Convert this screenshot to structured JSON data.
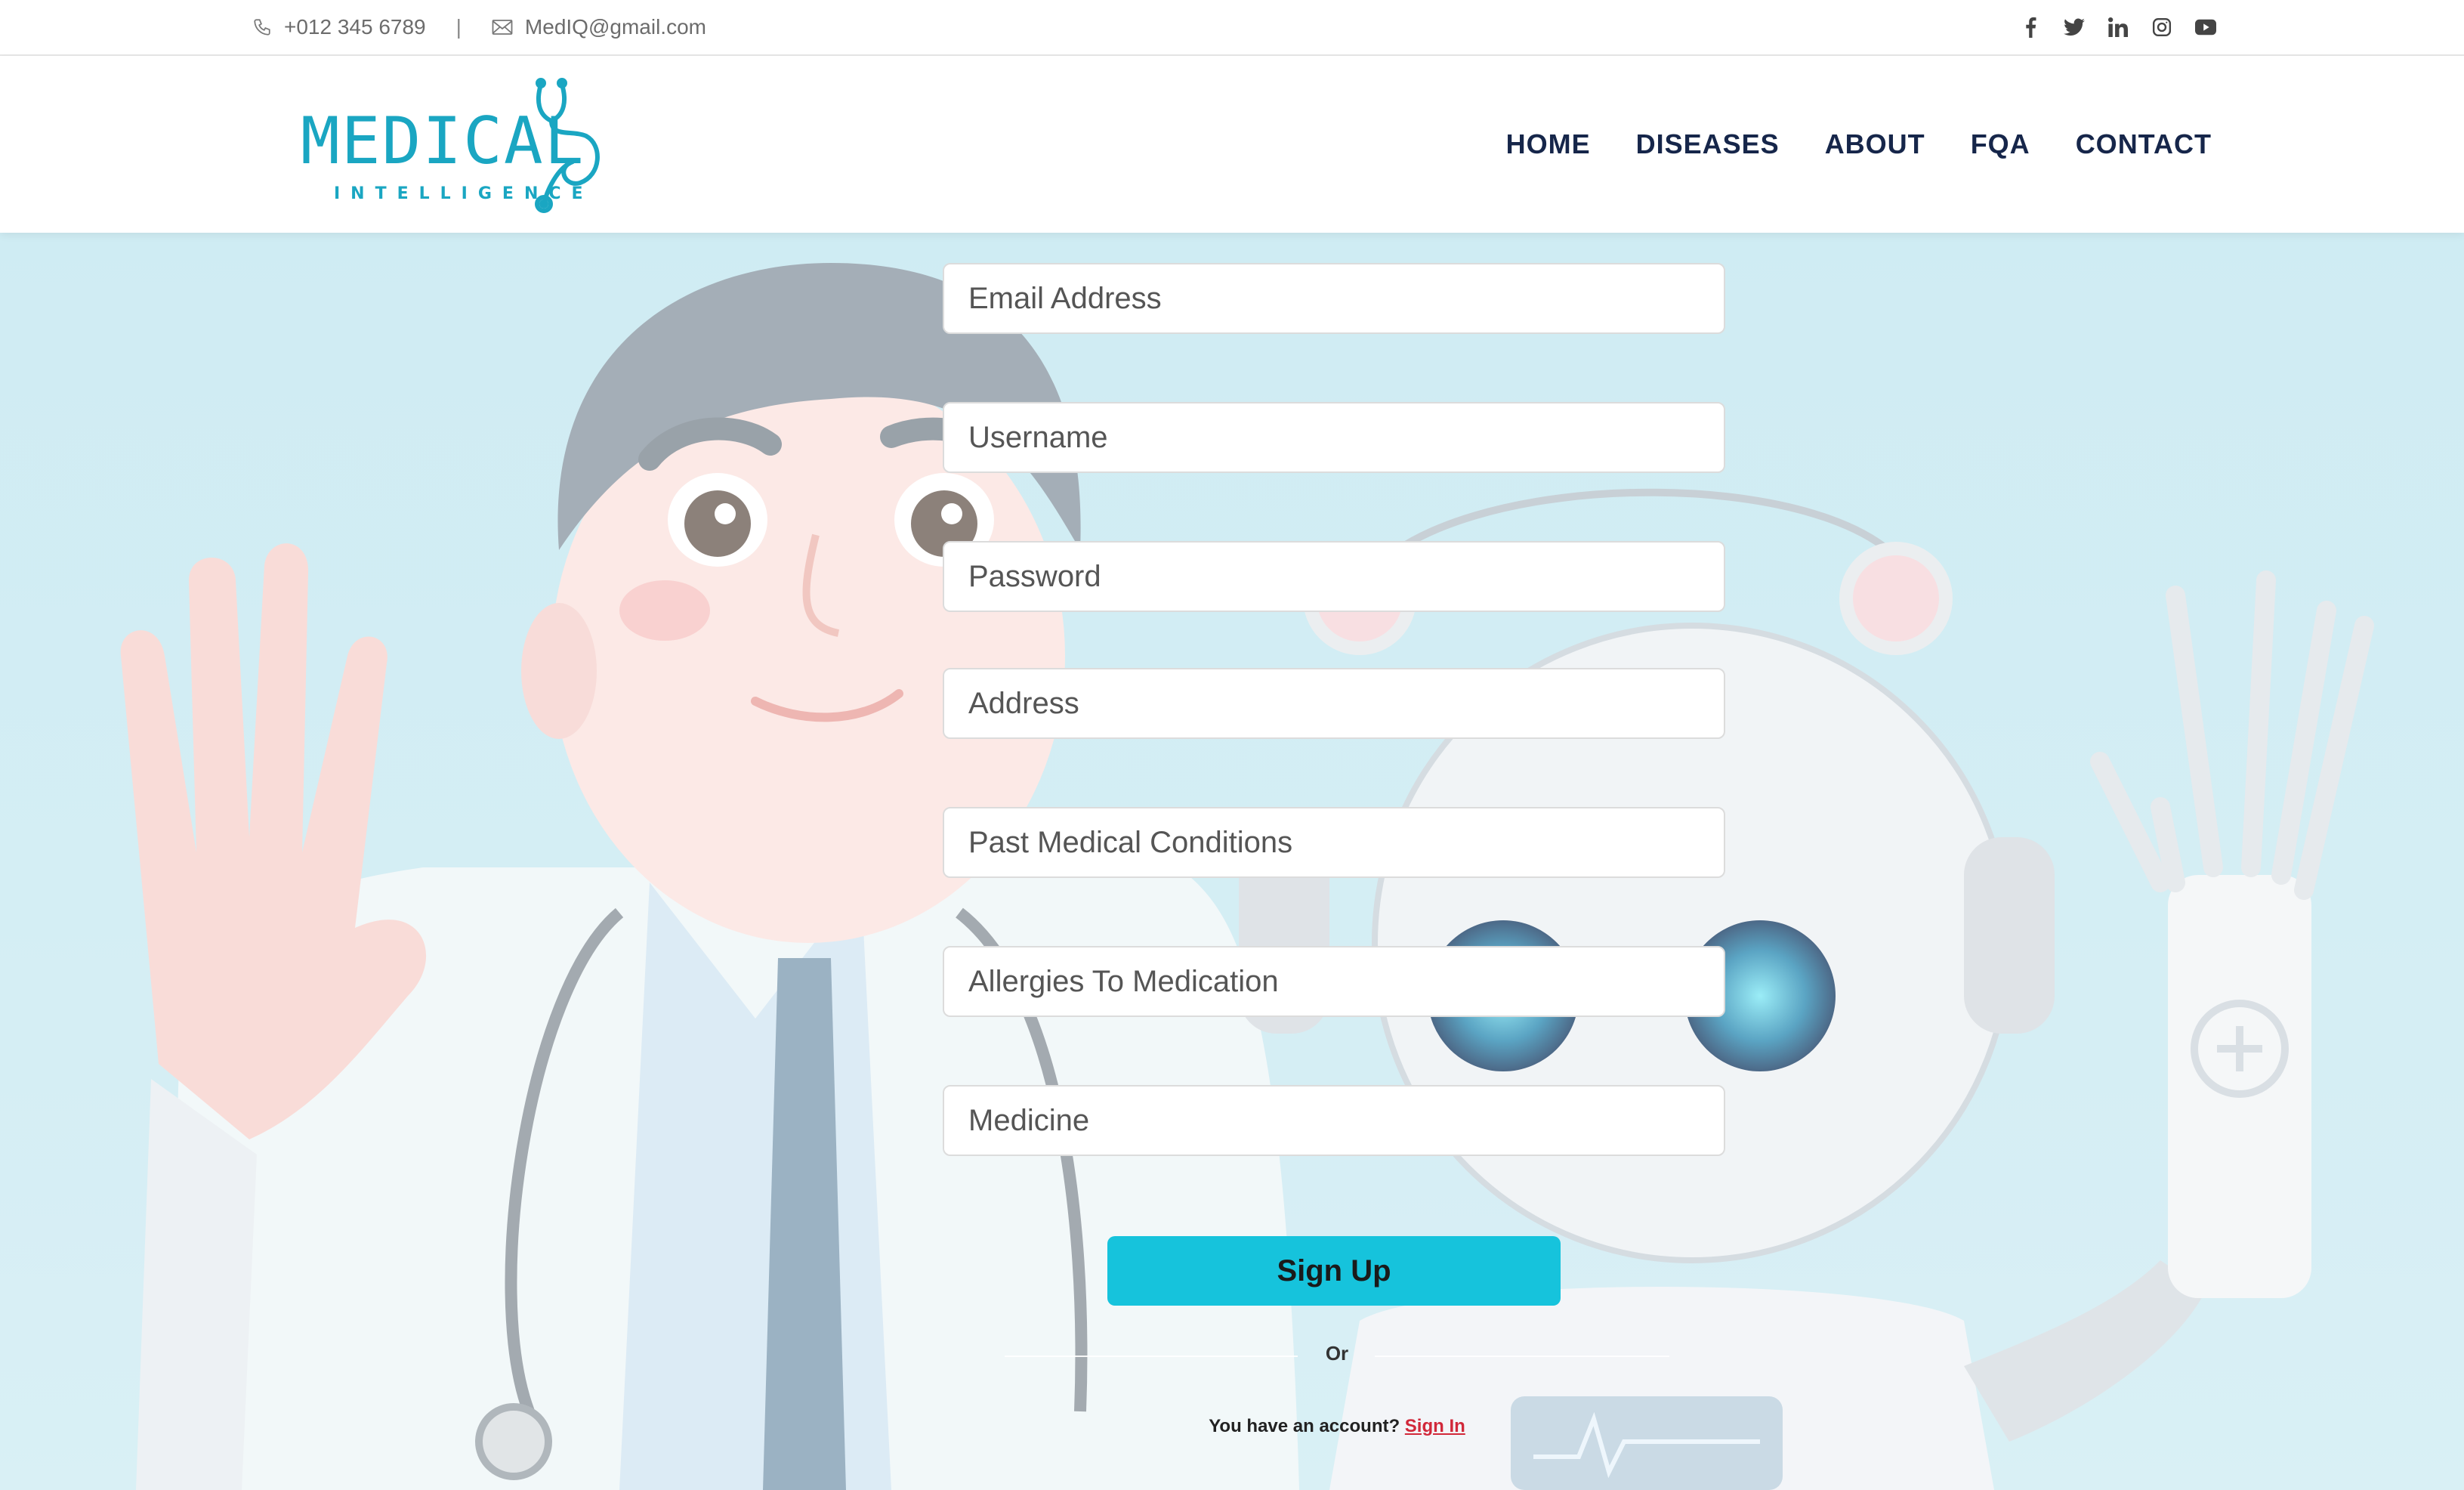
{
  "topbar": {
    "phone": "+012 345 6789",
    "separator": "|",
    "email": "MedIQ@gmail.com",
    "social_icons": [
      "facebook-icon",
      "twitter-icon",
      "linkedin-icon",
      "instagram-icon",
      "youtube-icon"
    ]
  },
  "logo": {
    "word": "MEDICAL",
    "sub": "INTELLIGENCE"
  },
  "nav": {
    "items": [
      "HOME",
      "DISEASES",
      "ABOUT",
      "FQA",
      "CONTACT"
    ]
  },
  "form": {
    "email_placeholder": "Email Address",
    "username_placeholder": "Username",
    "password_placeholder": "Password",
    "address_placeholder": "Address",
    "conditions_placeholder": "Past Medical Conditions",
    "allergies_placeholder": "Allergies To Medication",
    "medicine_placeholder": "Medicine",
    "submit_label": "Sign Up",
    "divider_text": "Or",
    "account_text": "You have an account?",
    "signin_link": "Sign In"
  },
  "colors": {
    "accent": "#16c3dc",
    "brand": "#1aa6c2",
    "nav_text": "#16264a",
    "link": "#d1283a",
    "hero_bg": "#c2e7f0"
  }
}
